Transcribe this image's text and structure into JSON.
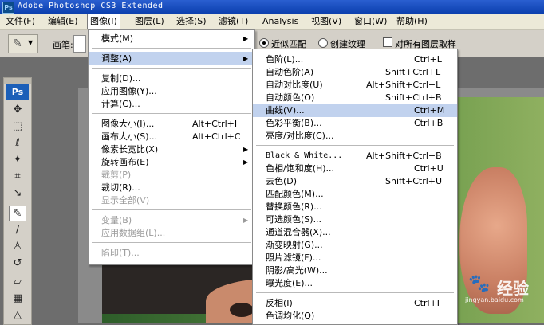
{
  "titlebar": {
    "icon": "Ps",
    "title": "Adobe Photoshop CS3 Extended"
  },
  "menubar": [
    {
      "label": "文件(F)"
    },
    {
      "label": "编辑(E)"
    },
    {
      "label": "图像(I)"
    },
    {
      "label": "图层(L)"
    },
    {
      "label": "选择(S)"
    },
    {
      "label": "滤镜(T)"
    },
    {
      "label": "Analysis"
    },
    {
      "label": "视图(V)"
    },
    {
      "label": "窗口(W)"
    },
    {
      "label": "帮助(H)"
    }
  ],
  "options": {
    "brush_label": "画笔:",
    "radio1": "近似匹配",
    "radio2": "创建纹理",
    "checkbox": "对所有图层取样"
  },
  "toolbox": {
    "logo": "Ps"
  },
  "image_menu": [
    {
      "label": "模式(M)",
      "arrow": "▶"
    },
    {
      "label": "调整(A)",
      "arrow": "▶"
    },
    {
      "label": "复制(D)..."
    },
    {
      "label": "应用图像(Y)..."
    },
    {
      "label": "计算(C)..."
    },
    {
      "label": "图像大小(I)...",
      "shortcut": "Alt+Ctrl+I"
    },
    {
      "label": "画布大小(S)...",
      "shortcut": "Alt+Ctrl+C"
    },
    {
      "label": "像素长宽比(X)",
      "arrow": "▶"
    },
    {
      "label": "旋转画布(E)",
      "arrow": "▶"
    },
    {
      "label": "裁剪(P)"
    },
    {
      "label": "裁切(R)..."
    },
    {
      "label": "显示全部(V)"
    },
    {
      "label": "变量(B)",
      "arrow": "▶"
    },
    {
      "label": "应用数据组(L)..."
    },
    {
      "label": "陷印(T)..."
    }
  ],
  "adjust_menu": [
    {
      "label": "色阶(L)...",
      "shortcut": "Ctrl+L"
    },
    {
      "label": "自动色阶(A)",
      "shortcut": "Shift+Ctrl+L"
    },
    {
      "label": "自动对比度(U)",
      "shortcut": "Alt+Shift+Ctrl+L"
    },
    {
      "label": "自动颜色(O)",
      "shortcut": "Shift+Ctrl+B"
    },
    {
      "label": "曲线(V)...",
      "shortcut": "Ctrl+M"
    },
    {
      "label": "色彩平衡(B)...",
      "shortcut": "Ctrl+B"
    },
    {
      "label": "亮度/对比度(C)..."
    },
    {
      "label": "Black & White...",
      "shortcut": "Alt+Shift+Ctrl+B"
    },
    {
      "label": "色相/饱和度(H)...",
      "shortcut": "Ctrl+U"
    },
    {
      "label": "去色(D)",
      "shortcut": "Shift+Ctrl+U"
    },
    {
      "label": "匹配颜色(M)..."
    },
    {
      "label": "替换颜色(R)..."
    },
    {
      "label": "可选颜色(S)..."
    },
    {
      "label": "通道混合器(X)..."
    },
    {
      "label": "渐变映射(G)..."
    },
    {
      "label": "照片滤镜(F)..."
    },
    {
      "label": "阴影/高光(W)..."
    },
    {
      "label": "曝光度(E)..."
    },
    {
      "label": "反相(I)",
      "shortcut": "Ctrl+I"
    },
    {
      "label": "色调均化(Q)"
    }
  ],
  "watermark": {
    "brand": "Bai",
    "paw": "🐾",
    "jingyan": "经验",
    "url": "jingyan.baidu.com"
  }
}
